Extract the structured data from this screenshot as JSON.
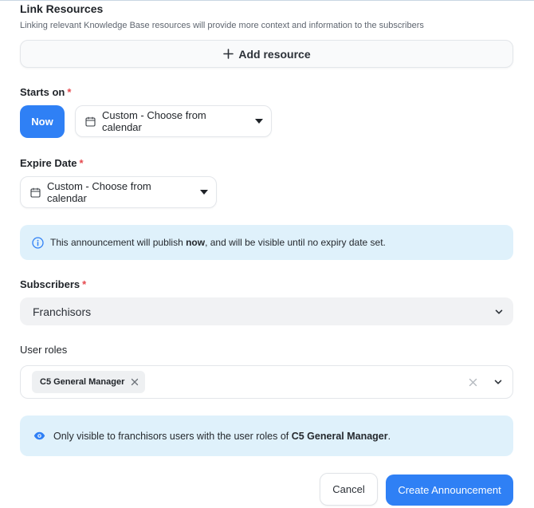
{
  "link_resources": {
    "title": "Link Resources",
    "subtitle": "Linking relevant Knowledge Base resources will provide more context and information to the subscribers",
    "add_label": "Add resource"
  },
  "starts_on": {
    "label": "Starts on",
    "required_mark": "*",
    "now_label": "Now",
    "custom_label": "Custom - Choose from calendar"
  },
  "expire_date": {
    "label": "Expire Date",
    "required_mark": "*",
    "custom_label": "Custom - Choose from calendar"
  },
  "publish_info": {
    "before": "This announcement will publish ",
    "bold": "now",
    "after": ", and will be visible until no expiry date set."
  },
  "subscribers": {
    "label": "Subscribers",
    "required_mark": "*",
    "value": "Franchisors"
  },
  "user_roles": {
    "label": "User roles",
    "chips": [
      "C5 General Manager"
    ]
  },
  "visibility_info": {
    "before": "Only visible to franchisors users with the user roles of ",
    "bold": "C5 General Manager",
    "after": "."
  },
  "footer": {
    "cancel_label": "Cancel",
    "create_label": "Create Announcement"
  },
  "colors": {
    "primary": "#2f80f5",
    "required": "#e5484d",
    "info_bg": "#dff1fb"
  },
  "icons": {
    "add": "plus-icon",
    "calendar": "calendar-icon",
    "info": "info-circle-icon",
    "eye": "eye-icon",
    "chevron": "chevron-down-icon",
    "close": "close-icon"
  }
}
